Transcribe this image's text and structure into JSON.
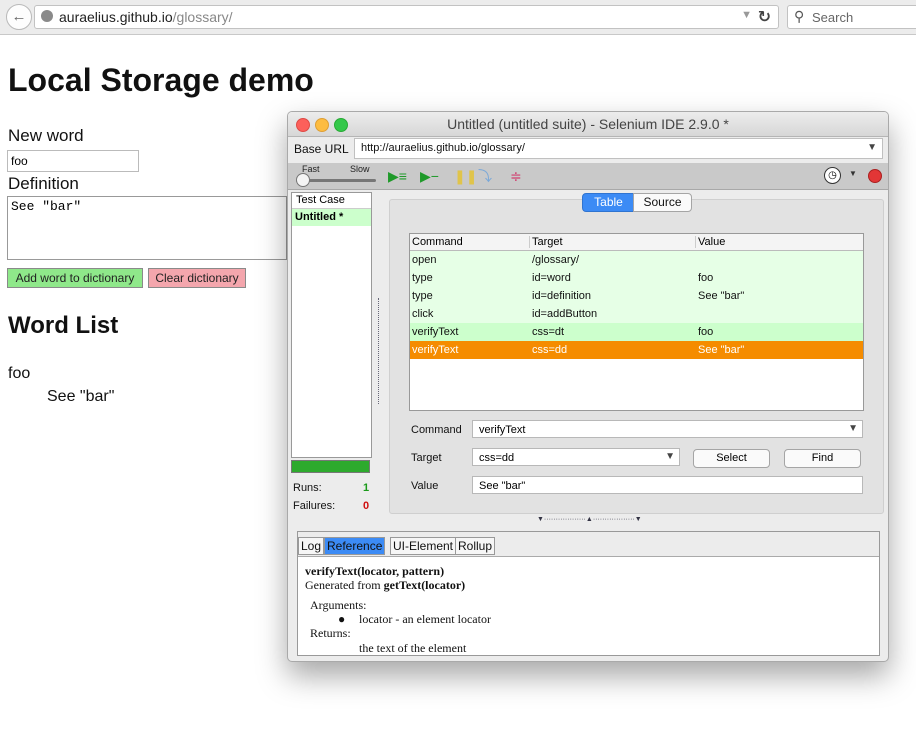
{
  "browser": {
    "url_host": "auraelius.github.io",
    "url_path": "/glossary/",
    "search_placeholder": "Search"
  },
  "page": {
    "title": "Local Storage demo",
    "new_word_label": "New word",
    "new_word_value": "foo",
    "definition_label": "Definition",
    "definition_value": "See \"bar\"",
    "add_button": "Add word to dictionary",
    "clear_button": "Clear dictionary",
    "word_list_heading": "Word List",
    "entries": [
      {
        "term": "foo",
        "definition": "See \"bar\""
      }
    ]
  },
  "ide": {
    "title": "Untitled (untitled suite) - Selenium IDE 2.9.0 *",
    "base_url_label": "Base URL",
    "base_url": "http://auraelius.github.io/glossary/",
    "speed_fast": "Fast",
    "speed_slow": "Slow",
    "test_case_header": "Test Case",
    "test_case": "Untitled *",
    "runs_label": "Runs:",
    "runs_value": "1",
    "failures_label": "Failures:",
    "failures_value": "0",
    "tabs": {
      "table": "Table",
      "source": "Source"
    },
    "columns": [
      "Command",
      "Target",
      "Value"
    ],
    "rows": [
      {
        "command": "open",
        "target": "/glossary/",
        "value": "",
        "state": "passed"
      },
      {
        "command": "type",
        "target": "id=word",
        "value": "foo",
        "state": "passed"
      },
      {
        "command": "type",
        "target": "id=definition",
        "value": "See \"bar\"",
        "state": "passed"
      },
      {
        "command": "click",
        "target": "id=addButton",
        "value": "",
        "state": "passed"
      },
      {
        "command": "verifyText",
        "target": "css=dt",
        "value": "foo",
        "state": "verified"
      },
      {
        "command": "verifyText",
        "target": "css=dd",
        "value": "See \"bar\"",
        "state": "selected"
      }
    ],
    "editor": {
      "command_label": "Command",
      "command_value": "verifyText",
      "target_label": "Target",
      "target_value": "css=dd",
      "value_label": "Value",
      "value_value": "See \"bar\"",
      "select_button": "Select",
      "find_button": "Find"
    },
    "bottom_tabs": [
      "Log",
      "Reference",
      "UI-Element",
      "Rollup"
    ],
    "active_bottom_tab": "Reference",
    "reference": {
      "signature": "verifyText(locator, pattern)",
      "generated_prefix": "Generated from ",
      "generated_from": "getText(locator)",
      "arguments_label": "Arguments:",
      "argument_item": "locator - an element locator",
      "returns_label": "Returns:",
      "returns_text": "the text of the element"
    },
    "colors": {
      "passed": "#e6ffe6",
      "verified": "#ccffcc",
      "selected": "#f58c00"
    }
  }
}
